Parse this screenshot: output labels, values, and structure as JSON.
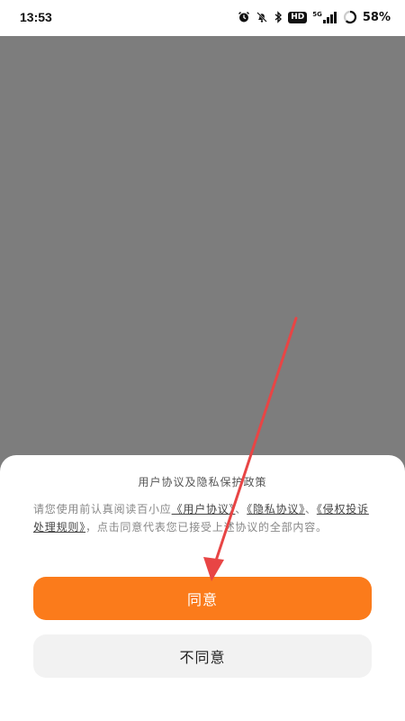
{
  "status_bar": {
    "time": "13:53",
    "network_label": "5G",
    "hd_label": "HD",
    "battery_percent": "58%",
    "icons": [
      "alarm-icon",
      "mute-icon",
      "bluetooth-icon",
      "hd-icon",
      "signal-icon",
      "battery-icon"
    ]
  },
  "consent_dialog": {
    "title": "用户协议及隐私保护政策",
    "body_prefix": "请您使用前认真阅读百小应",
    "link_user_agreement": "《用户协议》",
    "sep_1": "、",
    "link_privacy": "《隐私协议》",
    "sep_2": "、",
    "link_infringement": "《侵权投诉处理规则》",
    "body_suffix": "，点击同意代表您已接受上述协议的全部内容。",
    "agree_label": "同意",
    "disagree_label": "不同意"
  },
  "colors": {
    "accent": "#fb7b1b",
    "overlay": "#7d7d7d",
    "annotation_arrow": "#e84545",
    "secondary_button": "#f2f2f2"
  }
}
